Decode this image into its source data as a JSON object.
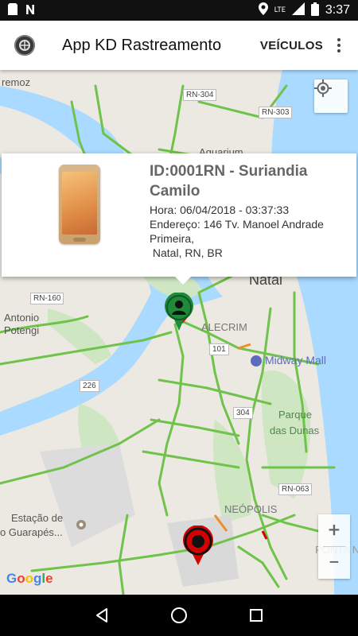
{
  "status_bar": {
    "time": "3:37",
    "network_label": "LTE",
    "icons": [
      "sd-card-icon",
      "n-notification-icon",
      "location-icon",
      "signal-icon",
      "battery-icon"
    ]
  },
  "app_bar": {
    "title": "App KD Rastreamento",
    "action_label": "VEÍCULOS"
  },
  "map": {
    "labels": {
      "remoz": "remoz",
      "rn304": "RN-304",
      "rn303": "RN-303",
      "aquarium": "Aquarium",
      "natal": "Natal",
      "rn160": "RN-160",
      "antonio_potengi_1": "Antonio",
      "antonio_potengi_2": "Potengi",
      "alecrim": "ALECRIM",
      "r101": "101",
      "midway": "Midway Mall",
      "r226": "226",
      "r304": "304",
      "parque_1": "Parque",
      "parque_2": "das Dunas",
      "rn063": "RN-063",
      "neopolis": "NEÓPOLIS",
      "estacao_1": "Estação de",
      "estacao_2": "o Guarapés...",
      "ponta": "PONTA N",
      "google": "Google"
    }
  },
  "info_window": {
    "title": "ID:0001RN - Suriandia Camilo",
    "hora": "Hora: 06/04/2018 - 03:37:33",
    "endereco_1": "Endereço: 146 Tv. Manoel Andrade",
    "endereco_2": "Primeira,",
    "endereco_3": " Natal, RN, BR"
  },
  "zoom": {
    "in": "+",
    "out": "−"
  },
  "colors": {
    "water": "#aadaff",
    "land": "#ece9e2",
    "park": "#cfe6c2",
    "traffic_road": "#6fc24a",
    "marker_green": "#1e8a3a",
    "marker_red": "#d50000"
  }
}
